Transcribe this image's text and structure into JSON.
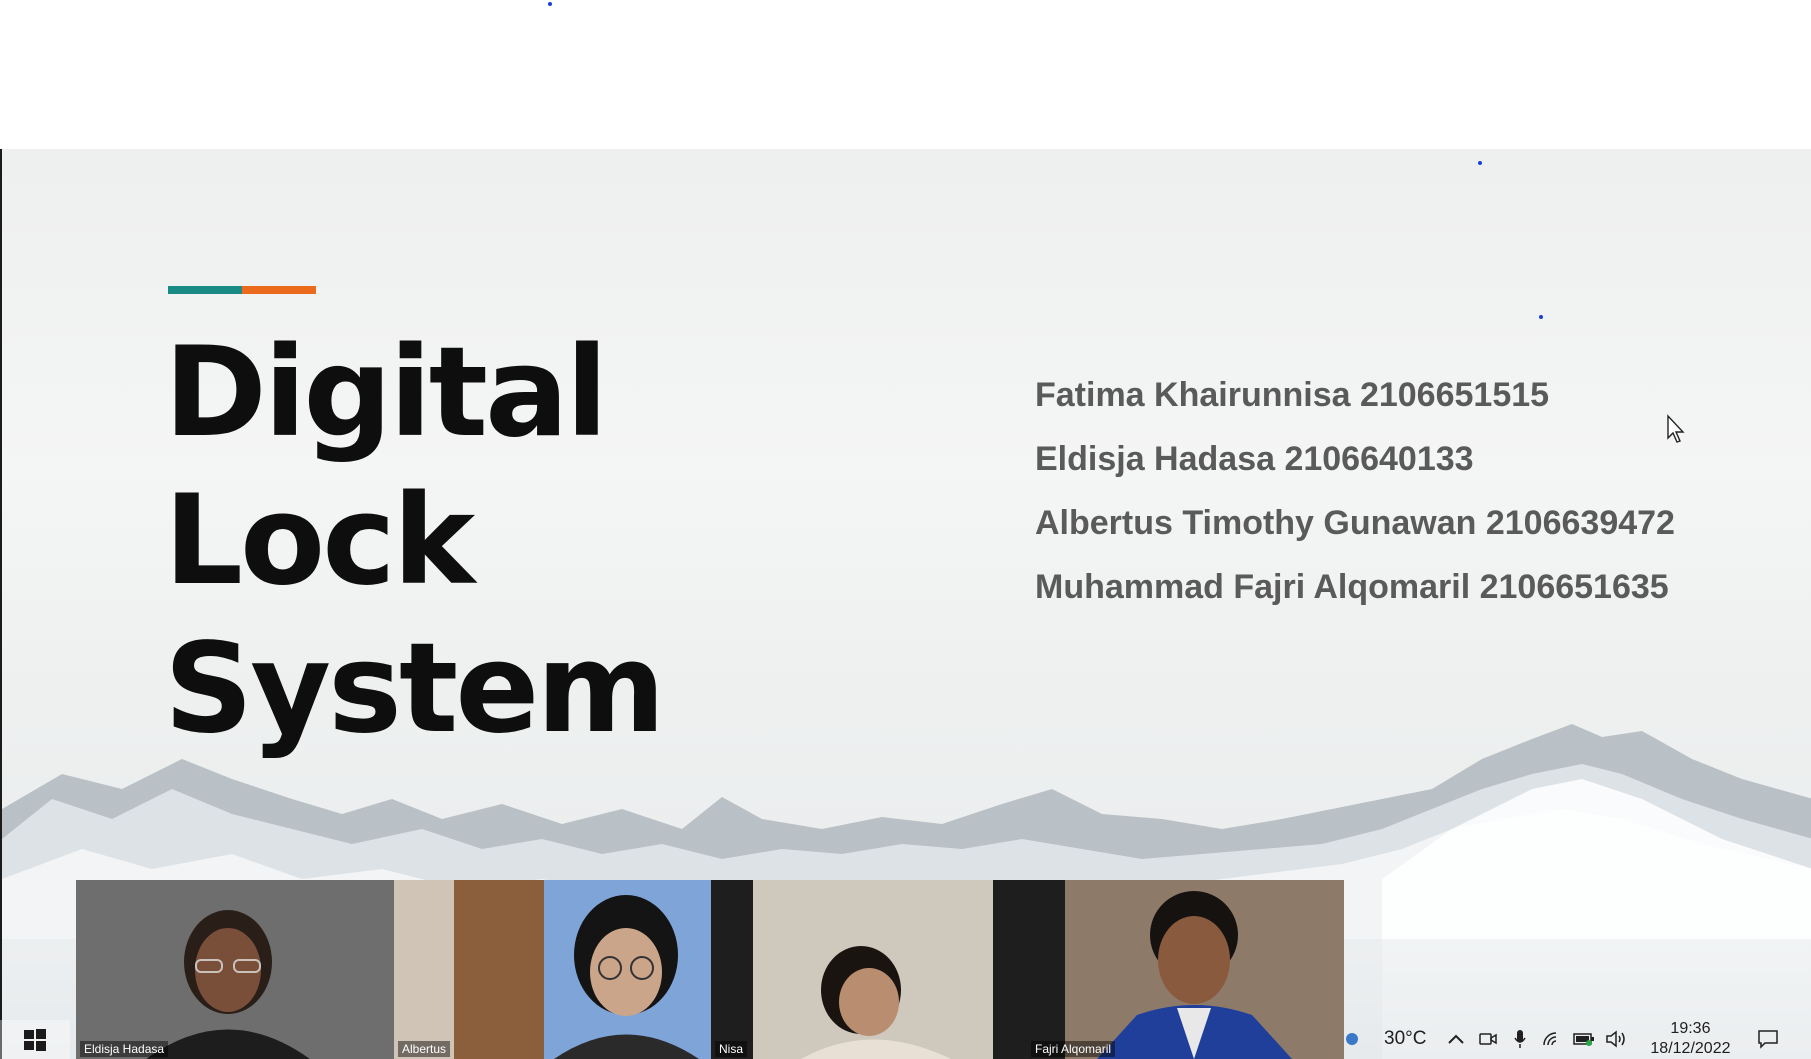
{
  "slide": {
    "title_line1": "Digital Lock",
    "title_line2": "System",
    "accent_colors": [
      "#1a8a84",
      "#ec6a1c"
    ],
    "members": [
      "Fatima Khairunnisa 2106651515",
      "Eldisja Hadasa 2106640133",
      "Albertus Timothy Gunawan 2106639472",
      "Muhammad Fajri Alqomaril 2106651635"
    ]
  },
  "video_call": {
    "participants": [
      {
        "name": "Eldisja Hadasa"
      },
      {
        "name": "Albertus"
      },
      {
        "name": "Nisa"
      },
      {
        "name": "Fajri Alqomaril"
      }
    ]
  },
  "taskbar": {
    "start_icon": "windows-logo-icon",
    "weather_icon": "weather-icon",
    "temperature": "30°C",
    "tray_icons": [
      "chevron-up-icon",
      "camera-icon",
      "microphone-icon",
      "wifi-icon",
      "battery-icon",
      "speaker-icon"
    ],
    "time": "19:36",
    "date": "18/12/2022",
    "notification_icon": "notification-icon"
  }
}
